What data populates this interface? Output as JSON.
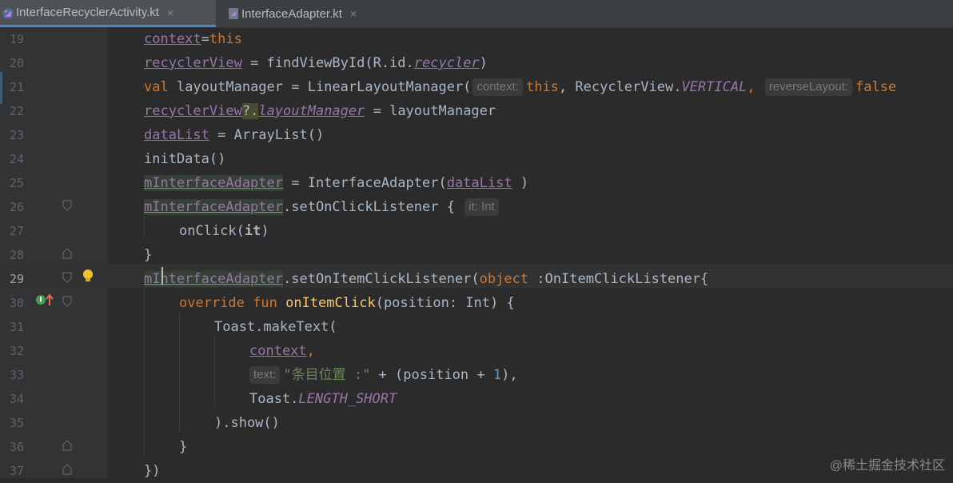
{
  "tabs": [
    {
      "label": "InterfaceRecyclerActivity.kt",
      "close": "×",
      "active": true
    },
    {
      "label": "InterfaceAdapter.kt",
      "close": "×",
      "active": false
    }
  ],
  "editor": {
    "current_line": "29",
    "lines": [
      {
        "num": "19"
      },
      {
        "num": "20"
      },
      {
        "num": "21"
      },
      {
        "num": "22"
      },
      {
        "num": "23"
      },
      {
        "num": "24"
      },
      {
        "num": "25"
      },
      {
        "num": "26"
      },
      {
        "num": "27"
      },
      {
        "num": "28"
      },
      {
        "num": "29"
      },
      {
        "num": "30"
      },
      {
        "num": "31"
      },
      {
        "num": "32"
      },
      {
        "num": "33"
      },
      {
        "num": "34"
      },
      {
        "num": "35"
      },
      {
        "num": "36"
      },
      {
        "num": "37"
      }
    ],
    "tokens": {
      "l19_a": "context",
      "l19_b": "=",
      "l19_c": "this",
      "l20_a": "recyclerView",
      "l20_b": " = findViewById(R.id.",
      "l20_c": "recycler",
      "l20_d": ")",
      "l21_a": "val",
      "l21_b": " layoutManager = LinearLayoutManager(",
      "l21_h1": "context:",
      "l21_c": "this",
      "l21_d": ", RecyclerView.",
      "l21_e": "VERTICAL",
      "l21_f": ", ",
      "l21_h2": "reverseLayout:",
      "l21_g": "false",
      "l22_a": "recyclerView",
      "l22_b": "?.",
      "l22_c": "layoutManager",
      "l22_d": " = layoutManager",
      "l23_a": "dataList",
      "l23_b": " = ArrayList()",
      "l24_a": "initData()",
      "l25_a": "mInterfaceAdapter",
      "l25_b": " = InterfaceAdapter(",
      "l25_c": "dataList",
      "l25_d": " )",
      "l26_a": "mInterfaceAdapter",
      "l26_b": ".setOnClickListener { ",
      "l26_h": "it: Int",
      "l27_a": "onClick(",
      "l27_b": "it",
      "l27_c": ")",
      "l28_a": "}",
      "l29_a": "mInterfaceAdapter",
      "l29_b": ".setOnItemClickListener(",
      "l29_c": "object",
      "l29_d": " :OnItemClickListener{",
      "l30_a": "override",
      "l30_b": " ",
      "l30_c": "fun",
      "l30_d": " ",
      "l30_e": "onItemClick",
      "l30_f": "(position: Int) {",
      "l31_a": "Toast.makeText(",
      "l32_a": "context",
      "l32_b": ",",
      "l33_h": "text:",
      "l33_a": "\"条目位置 :\"",
      "l33_b": " + (position + ",
      "l33_c": "1",
      "l33_d": "),",
      "l34_a": "Toast.",
      "l34_b": "LENGTH_SHORT",
      "l35_a": ").show()",
      "l36_a": "}",
      "l37_a": "})"
    }
  },
  "watermark": "@稀土掘金技术社区",
  "colors": {
    "background": "#2b2b2b",
    "gutter": "#313335",
    "keyword": "#cc7832",
    "property": "#9876aa",
    "function": "#ffc66d",
    "string": "#6a8759",
    "number": "#6897bb",
    "text": "#a9b7c6"
  },
  "icons": [
    "kotlin-file-icon",
    "kotlin-class-icon",
    "close-icon",
    "fold-icon",
    "lightbulb-icon",
    "override-icon"
  ]
}
